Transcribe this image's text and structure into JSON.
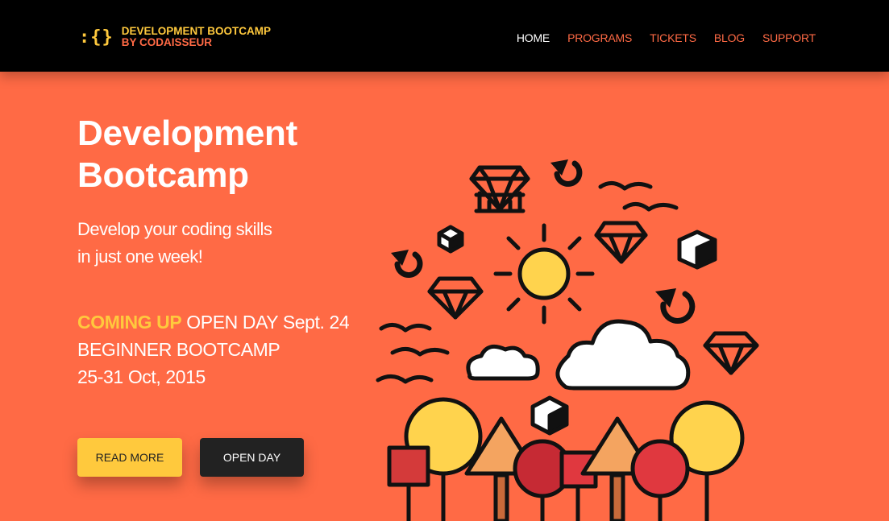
{
  "header": {
    "logo_mark": ":{}",
    "brand_line1": "DEVELOPMENT BOOTCAMP",
    "brand_line2": "BY CODAISSEUR",
    "nav": [
      {
        "label": "HOME",
        "active": true
      },
      {
        "label": "PROGRAMS",
        "active": false
      },
      {
        "label": "TICKETS",
        "active": false
      },
      {
        "label": "BLOG",
        "active": false
      },
      {
        "label": "SUPPORT",
        "active": false
      }
    ]
  },
  "hero": {
    "title_line1": "Development",
    "title_line2": "Bootcamp",
    "tagline_line1": "Develop your coding skills",
    "tagline_line2": "in just one week!",
    "coming_up": "COMING UP",
    "open_day": "OPEN DAY Sept. 24",
    "bootcamp": "BEGINNER BOOTCAMP",
    "dates": "25-31 Oct, 2015"
  },
  "buttons": {
    "read_more": "READ MORE",
    "open_day": "OPEN DAY"
  },
  "colors": {
    "background": "#ff6a45",
    "accent_yellow": "#ffc93d",
    "topbar": "#000000",
    "dark_button": "#222222"
  }
}
